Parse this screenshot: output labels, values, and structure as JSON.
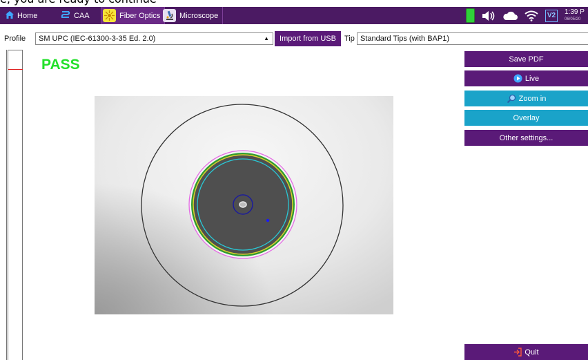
{
  "window": {
    "top_text": "e, you are ready to continue"
  },
  "topbar": {
    "tabs": [
      {
        "label": "Home",
        "icon": "home-icon"
      },
      {
        "label": "CAA",
        "icon": "caa-icon"
      },
      {
        "label": "Fiber Optics",
        "icon": "fiber-optics-icon"
      },
      {
        "label": "Microscope",
        "icon": "microscope-icon"
      }
    ],
    "status": {
      "battery_icon": "battery-icon",
      "volume_icon": "volume-icon",
      "cloud_icon": "cloud-icon",
      "wifi_icon": "wifi-icon",
      "badge": "V2",
      "time": "1:39 P",
      "date": "06/05/20"
    }
  },
  "profile": {
    "label": "Profile",
    "value": "SM UPC (IEC-61300-3-35 Ed. 2.0)",
    "import_button": "Import from USB",
    "tip_label": "Tip",
    "tip_value": "Standard Tips (with BAP1)"
  },
  "result": {
    "status": "PASS",
    "status_color": "#22e02a"
  },
  "actions": {
    "save_pdf": "Save PDF",
    "live": "Live",
    "zoom_in": "Zoom in",
    "overlay": "Overlay",
    "other_settings": "Other settings...",
    "quit": "Quit"
  },
  "colors": {
    "brand_purple": "#5a1a78",
    "accent_teal": "#1aa3c9",
    "header": "#4b1a63"
  }
}
